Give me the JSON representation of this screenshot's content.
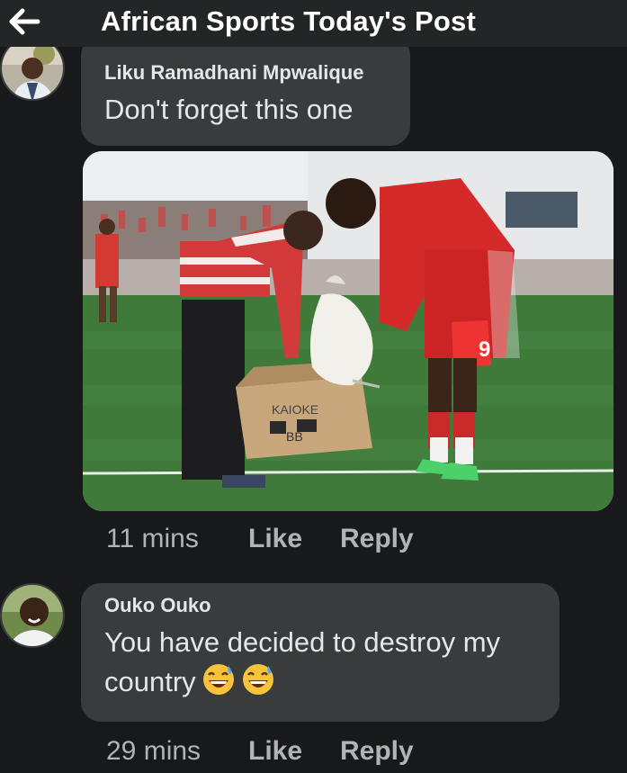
{
  "header": {
    "back_icon": "arrow-left-icon",
    "title": "African Sports Today's Post"
  },
  "comments": [
    {
      "author": "Liku Ramadhani Mpwalique",
      "text": "Don't forget this one",
      "attachment": {
        "type": "photo",
        "box_text": "KAIOKE",
        "box_number": "BB",
        "jersey_number": "9"
      },
      "time": "11 mins",
      "like_label": "Like",
      "reply_label": "Reply"
    },
    {
      "author": "Ouko Ouko",
      "text": "You have decided to destroy my country",
      "emojis": [
        "grinning-sweat-emoji",
        "grinning-sweat-emoji"
      ],
      "time": "29 mins",
      "like_label": "Like",
      "reply_label": "Reply"
    }
  ],
  "colors": {
    "background": "#18191a",
    "header": "#242526",
    "bubble": "#3a3b3c",
    "text": "#e4e6eb",
    "secondary_text": "#b0b3b8"
  }
}
